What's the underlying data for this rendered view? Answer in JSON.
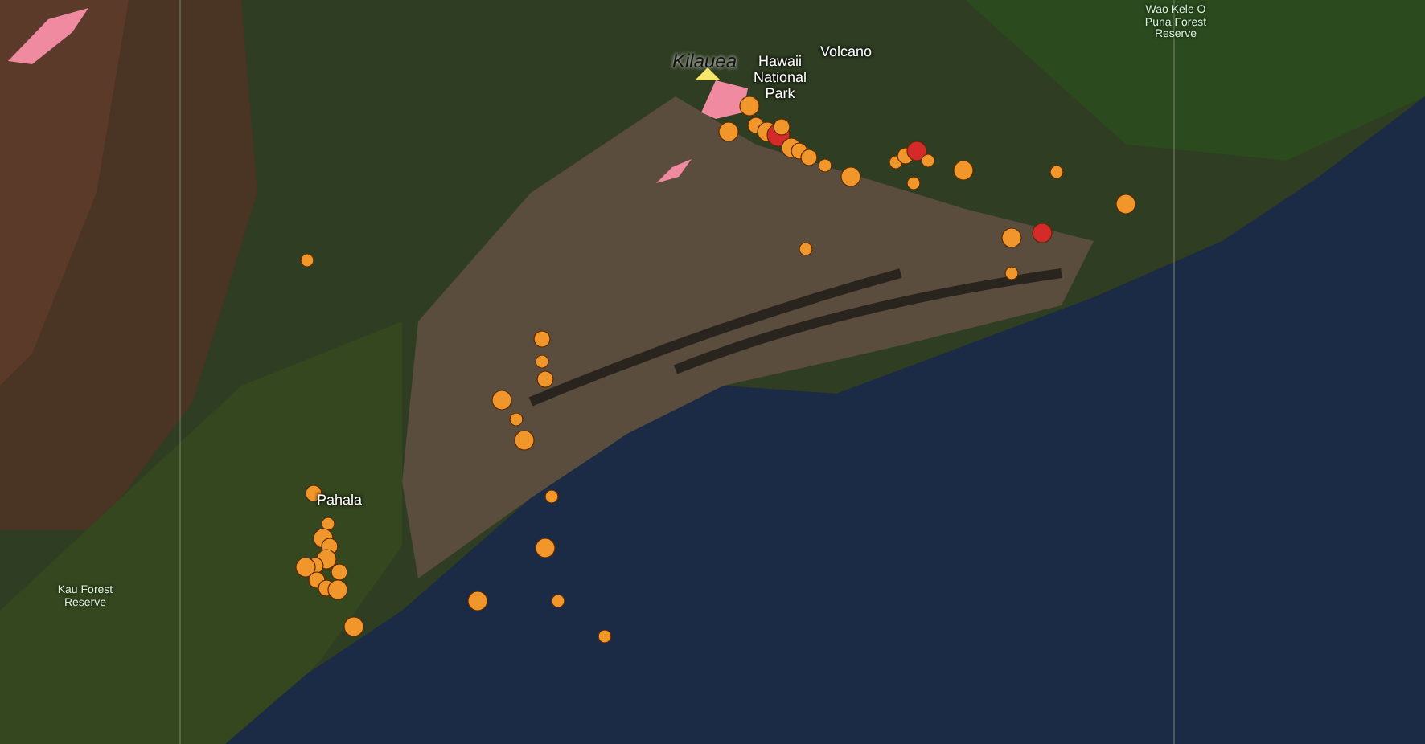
{
  "map": {
    "labels": [
      {
        "text": "Kilauea",
        "kind": "volcano"
      },
      {
        "text": "Hawaii National Park",
        "kind": "place"
      },
      {
        "text": "Volcano",
        "kind": "place"
      },
      {
        "text": "Wao Kele O Puna Forest Reserve",
        "kind": "reserve"
      },
      {
        "text": "Pahala",
        "kind": "place"
      },
      {
        "text": "Kau Forest Reserve",
        "kind": "reserve"
      }
    ],
    "earthquakes": [
      {
        "color": "#f0962a"
      },
      {
        "color": "#f0962a"
      },
      {
        "color": "#f0962a"
      },
      {
        "color": "#f0962a"
      },
      {
        "color": "#f0962a"
      },
      {
        "color": "#d42a2a"
      },
      {
        "color": "#f0962a"
      },
      {
        "color": "#f0962a"
      },
      {
        "color": "#f0962a"
      },
      {
        "color": "#f0962a"
      },
      {
        "color": "#f0962a"
      },
      {
        "color": "#f0962a"
      },
      {
        "color": "#f0962a"
      },
      {
        "color": "#f0962a"
      },
      {
        "color": "#d42a2a"
      },
      {
        "color": "#f0962a"
      },
      {
        "color": "#f0962a"
      },
      {
        "color": "#f0962a"
      },
      {
        "color": "#f0962a"
      },
      {
        "color": "#f0962a"
      },
      {
        "color": "#d42a2a"
      },
      {
        "color": "#f0962a"
      },
      {
        "color": "#f0962a"
      },
      {
        "color": "#f0962a"
      },
      {
        "color": "#f0962a"
      },
      {
        "color": "#f0962a"
      },
      {
        "color": "#f0962a"
      },
      {
        "color": "#f0962a"
      },
      {
        "color": "#f0962a"
      },
      {
        "color": "#f0962a"
      },
      {
        "color": "#f0962a"
      },
      {
        "color": "#f0962a"
      },
      {
        "color": "#f0962a"
      },
      {
        "color": "#f0962a"
      },
      {
        "color": "#f0962a"
      },
      {
        "color": "#f0962a"
      },
      {
        "color": "#f0962a"
      },
      {
        "color": "#f0962a"
      },
      {
        "color": "#f0962a"
      },
      {
        "color": "#f0962a"
      },
      {
        "color": "#f0962a"
      },
      {
        "color": "#f0962a"
      },
      {
        "color": "#f0962a"
      },
      {
        "color": "#f0962a"
      },
      {
        "color": "#f0962a"
      },
      {
        "color": "#f0962a"
      },
      {
        "color": "#f0962a"
      }
    ]
  }
}
